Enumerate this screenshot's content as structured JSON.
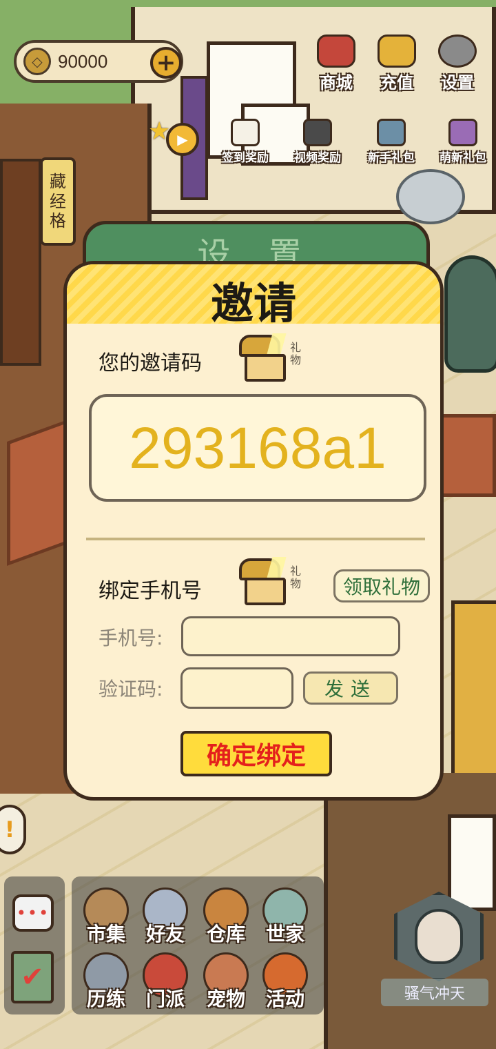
{
  "hud": {
    "coins": "90000",
    "plus_label": "+",
    "top_buttons": [
      {
        "label": "商城",
        "color": "#c4473b"
      },
      {
        "label": "充值",
        "color": "#e4b23a"
      },
      {
        "label": "设置",
        "color": "#8a8a8a"
      }
    ],
    "sub_buttons": [
      {
        "label": "签到奖励",
        "color": "#f5f1e6"
      },
      {
        "label": "视频奖励",
        "color": "#4a4a4a"
      },
      {
        "label": "新手礼包",
        "color": "#6c8fa6"
      },
      {
        "label": "萌新礼包",
        "color": "#9a6cb5"
      }
    ],
    "side_sign": [
      "藏",
      "经",
      "格"
    ]
  },
  "settings_panel_title": "设 置",
  "invite": {
    "title": "邀请",
    "my_code_label": "您的邀请码",
    "gift_tag": "礼物",
    "code": "293168a1",
    "bind_phone_label": "绑定手机号",
    "receive_label": "领取礼物",
    "phone_label": "手机号:",
    "phone_value": "",
    "verify_label": "验证码:",
    "verify_value": "",
    "send_label": "发送",
    "confirm_label": "确定绑定"
  },
  "bottom": {
    "chat_icon": "chat-icon",
    "task_icon": "task-check-icon",
    "menu": [
      {
        "label": "市集",
        "color": "#b58a58"
      },
      {
        "label": "好友",
        "color": "#aab6c8"
      },
      {
        "label": "仓库",
        "color": "#c9853f"
      },
      {
        "label": "世家",
        "color": "#8fb5ab"
      },
      {
        "label": "历练",
        "color": "#8f9aa6"
      },
      {
        "label": "门派",
        "color": "#c94a3a"
      },
      {
        "label": "宠物",
        "color": "#c97a52"
      },
      {
        "label": "活动",
        "color": "#d66a2f"
      }
    ],
    "player_title": "骚气冲天"
  },
  "colors": {
    "code_color": "#e3b21e",
    "confirm_text": "#e4201c",
    "receive_text": "#2e6f3a"
  }
}
